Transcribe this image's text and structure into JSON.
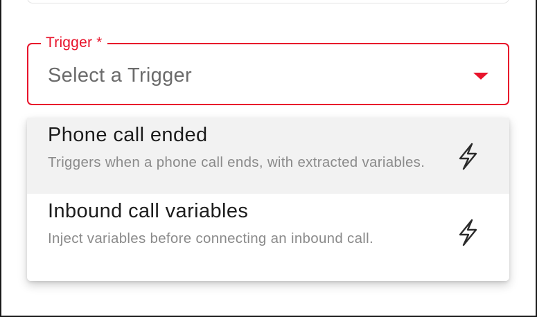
{
  "trigger_field": {
    "label": "Trigger *",
    "placeholder": "Select a Trigger"
  },
  "colors": {
    "accent": "#e8132b",
    "option_highlight": "#f2f2f2",
    "description_text": "#8a8a8a"
  },
  "options": [
    {
      "title": "Phone call ended",
      "description": "Triggers when a phone call ends, with extracted variables.",
      "icon": "lightning-bolt-icon",
      "highlighted": true
    },
    {
      "title": "Inbound call variables",
      "description": "Inject variables before connecting an inbound call.",
      "icon": "lightning-bolt-icon",
      "highlighted": false
    }
  ]
}
